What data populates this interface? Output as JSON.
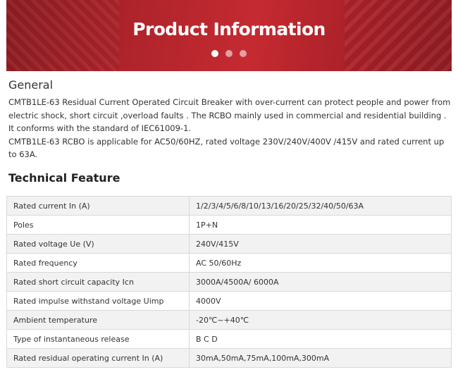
{
  "banner": {
    "title": "Product Information",
    "slides": 3,
    "active_slide": 1
  },
  "general": {
    "heading": "General",
    "paragraphs": [
      "CMTB1LE-63 Residual Current Operated Circuit Breaker with over-current can protect people and power from electric shock, short circuit ,overload faults . The RCBO mainly used in commercial and residential building .",
      "It conforms with the standard of IEC61009-1.",
      "CMTB1LE-63 RCBO is applicable for AC50/60HZ, rated voltage 230V/240V/400V /415V and rated current up to 63A."
    ]
  },
  "technical": {
    "heading": "Technical Feature",
    "rows": [
      {
        "label": "Rated current In (A)",
        "value": "1/2/3/4/5/6/8/10/13/16/20/25/32/40/50/63A"
      },
      {
        "label": "Poles",
        "value": "1P+N"
      },
      {
        "label": "Rated voltage Ue (V)",
        "value": "240V/415V"
      },
      {
        "label": "Rated frequency",
        "value": "AC 50/60Hz"
      },
      {
        "label": "Rated short circuit capacity Icn",
        "value": "3000A/4500A/ 6000A"
      },
      {
        "label": "Rated impulse withstand voltage Uimp",
        "value": "4000V"
      },
      {
        "label": "Ambient temperature",
        "value": "-20℃~+40℃"
      },
      {
        "label": "Type of instantaneous release",
        "value": "B C D"
      },
      {
        "label": "Rated residual operating current In (A)",
        "value": "30mA,50mA,75mA,100mA,300mA"
      }
    ]
  },
  "colors": {
    "banner_red": "#b0242b",
    "table_stripe": "#f2f2f2",
    "border": "#d8d8d8"
  }
}
